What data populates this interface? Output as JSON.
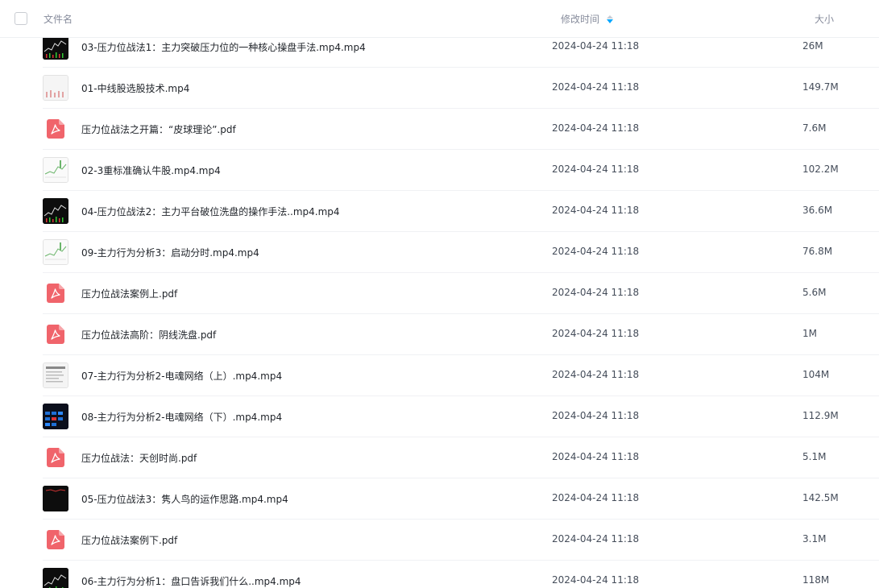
{
  "header": {
    "col_name": "文件名",
    "col_time": "修改时间",
    "col_size": "大小"
  },
  "colors": {
    "pdf_icon": "#f0646b",
    "sort_active": "#06a7ff",
    "header_text": "#878c9c"
  },
  "files": [
    {
      "name": "03-压力位战法1：主力突破压力位的一种核心操盘手法.mp4.mp4",
      "time": "2024-04-24 11:18",
      "size": "26M",
      "icon": "video-thumbnail-icon",
      "thumb": "dark-chart"
    },
    {
      "name": "01-中线股选股技术.mp4",
      "time": "2024-04-24 11:18",
      "size": "149.7M",
      "icon": "video-thumbnail-icon",
      "thumb": "light-bars"
    },
    {
      "name": "压力位战法之开篇：“皮球理论”.pdf",
      "time": "2024-04-24 11:18",
      "size": "7.6M",
      "icon": "pdf-icon",
      "thumb": "pdf"
    },
    {
      "name": "02-3重标准确认牛股.mp4.mp4",
      "time": "2024-04-24 11:18",
      "size": "102.2M",
      "icon": "video-thumbnail-icon",
      "thumb": "light-chart"
    },
    {
      "name": "04-压力位战法2：主力平台破位洗盘的操作手法..mp4.mp4",
      "time": "2024-04-24 11:18",
      "size": "36.6M",
      "icon": "video-thumbnail-icon",
      "thumb": "dark-chart"
    },
    {
      "name": "09-主力行为分析3：启动分时.mp4.mp4",
      "time": "2024-04-24 11:18",
      "size": "76.8M",
      "icon": "video-thumbnail-icon",
      "thumb": "light-chart"
    },
    {
      "name": "压力位战法案例上.pdf",
      "time": "2024-04-24 11:18",
      "size": "5.6M",
      "icon": "pdf-icon",
      "thumb": "pdf"
    },
    {
      "name": "压力位战法高阶：阴线洗盘.pdf",
      "time": "2024-04-24 11:18",
      "size": "1M",
      "icon": "pdf-icon",
      "thumb": "pdf"
    },
    {
      "name": "07-主力行为分析2-电魂网络（上）.mp4.mp4",
      "time": "2024-04-24 11:18",
      "size": "104M",
      "icon": "video-thumbnail-icon",
      "thumb": "light-doc"
    },
    {
      "name": "08-主力行为分析2-电魂网络（下）.mp4.mp4",
      "time": "2024-04-24 11:18",
      "size": "112.9M",
      "icon": "video-thumbnail-icon",
      "thumb": "dark-blue"
    },
    {
      "name": "压力位战法：天创时尚.pdf",
      "time": "2024-04-24 11:18",
      "size": "5.1M",
      "icon": "pdf-icon",
      "thumb": "pdf"
    },
    {
      "name": "05-压力位战法3：隽人鸟的运作思路.mp4.mp4",
      "time": "2024-04-24 11:18",
      "size": "142.5M",
      "icon": "video-thumbnail-icon",
      "thumb": "dark-plain"
    },
    {
      "name": "压力位战法案例下.pdf",
      "time": "2024-04-24 11:18",
      "size": "3.1M",
      "icon": "pdf-icon",
      "thumb": "pdf"
    },
    {
      "name": "06-主力行为分析1：盘口告诉我们什么..mp4.mp4",
      "time": "2024-04-24 11:18",
      "size": "118M",
      "icon": "video-thumbnail-icon",
      "thumb": "dark-chart"
    }
  ]
}
